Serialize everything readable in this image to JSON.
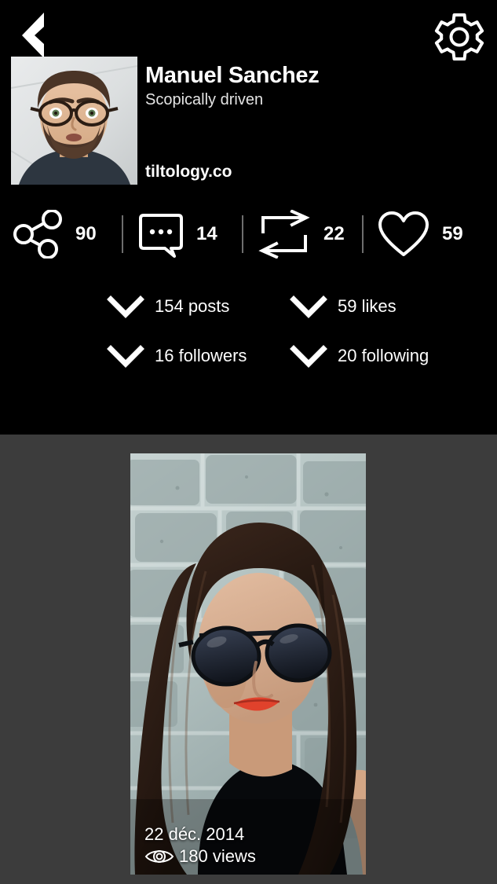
{
  "header": {
    "back_icon": "back-chevron-icon",
    "settings_icon": "gear-icon",
    "avatar_icon": "avatar-photo",
    "name": "Manuel Sanchez",
    "tagline": "Scopically driven",
    "website": "tiltology.co"
  },
  "stats": [
    {
      "icon": "share-icon",
      "value": "90"
    },
    {
      "icon": "comment-icon",
      "value": "14"
    },
    {
      "icon": "repost-icon",
      "value": "22"
    },
    {
      "icon": "heart-icon",
      "value": "59"
    }
  ],
  "counts": [
    {
      "icon": "chevron-down-icon",
      "label": "154 posts"
    },
    {
      "icon": "chevron-down-icon",
      "label": "59 likes"
    },
    {
      "icon": "chevron-down-icon",
      "label": "16 followers"
    },
    {
      "icon": "chevron-down-icon",
      "label": "20 following"
    }
  ],
  "post": {
    "image_alt": "woman-with-sunglasses-stone-wall",
    "date": "22 déc. 2014",
    "views_icon": "eye-icon",
    "views": "180 views"
  },
  "colors": {
    "header_background": "#000000",
    "page_background": "#3c3c3c",
    "text_primary": "#ffffff",
    "text_secondary": "#e4e4e4",
    "separator": "#6e6e6e"
  }
}
